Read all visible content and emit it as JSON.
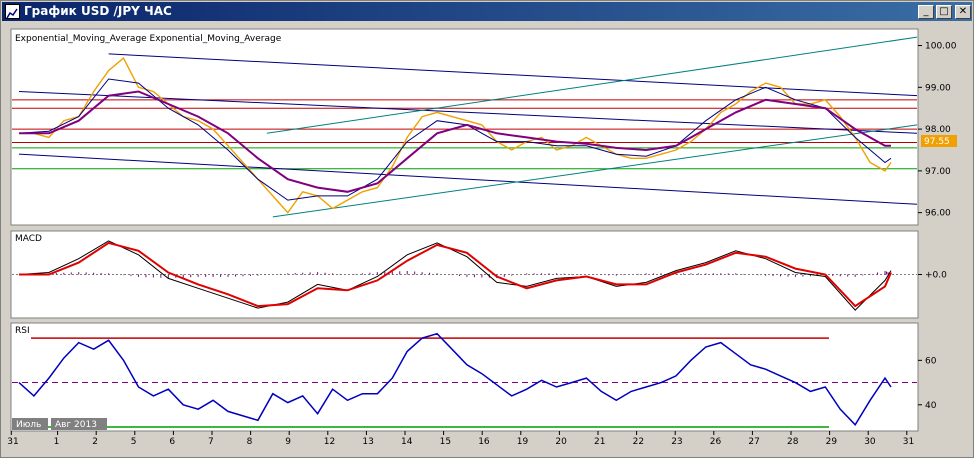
{
  "window": {
    "title": "График USD /JPY ЧАС",
    "minimize_glyph": "_",
    "maximize_glyph": "□",
    "close_glyph": "✕",
    "icon": "chart-icon"
  },
  "colors": {
    "background": "#d4d0c8",
    "plot_bg": "#ffffff",
    "price": "#f0a000",
    "ema_fast": "#000080",
    "ema_slow": "#800080",
    "channel": "#000080",
    "trend": "#008080",
    "resistance": "#c00000",
    "support": "#00a000",
    "macd_line": "#000000",
    "macd_signal": "#e00000",
    "macd_hist": "#800080",
    "rsi": "#0000c0"
  },
  "chart_data": [
    {
      "type": "line",
      "title": "Exponential_Moving_Average Exponential_Moving_Average",
      "yticks": [
        96.0,
        97.0,
        98.0,
        99.0,
        100.0
      ],
      "ylim": [
        95.8,
        100.3
      ],
      "current_price_label": "97.55",
      "current_price": 97.55,
      "horizontal_levels": [
        {
          "value": 98.7,
          "color": "#c00000"
        },
        {
          "value": 98.5,
          "color": "#c00000"
        },
        {
          "value": 98.0,
          "color": "#c00000"
        },
        {
          "value": 97.68,
          "color": "#c00000"
        },
        {
          "value": 97.55,
          "color": "#00a000"
        },
        {
          "value": 97.05,
          "color": "#00a000"
        }
      ],
      "series": [
        {
          "key": "price",
          "x": [
            0,
            0.5,
            1,
            1.5,
            2,
            2.5,
            3,
            3.5,
            4,
            4.5,
            5,
            5.5,
            6,
            6.5,
            7,
            7.5,
            8,
            8.5,
            9,
            9.5,
            10,
            10.5,
            11,
            11.5,
            12,
            12.5,
            13,
            13.5,
            14,
            14.5,
            15,
            15.5,
            16,
            16.5,
            17,
            17.5,
            18,
            18.5,
            19,
            19.5,
            20,
            20.5,
            21,
            21.5,
            22,
            22.5,
            23,
            23.5,
            24,
            24.5,
            25,
            25.5,
            26,
            26.5,
            27,
            27.5,
            28,
            28.5,
            29,
            29.2
          ],
          "values": [
            97.9,
            97.9,
            97.8,
            98.2,
            98.3,
            98.9,
            99.4,
            99.7,
            99.0,
            98.9,
            98.6,
            98.3,
            98.2,
            98.0,
            97.6,
            97.2,
            96.8,
            96.4,
            96.0,
            96.5,
            96.4,
            96.1,
            96.3,
            96.5,
            96.6,
            97.1,
            97.8,
            98.3,
            98.4,
            98.3,
            98.2,
            98.1,
            97.7,
            97.5,
            97.7,
            97.8,
            97.5,
            97.6,
            97.8,
            97.6,
            97.4,
            97.3,
            97.3,
            97.4,
            97.5,
            97.7,
            98.0,
            98.4,
            98.6,
            98.9,
            99.1,
            99.0,
            98.6,
            98.6,
            98.7,
            98.3,
            97.8,
            97.2,
            97.0,
            97.2
          ]
        },
        {
          "key": "ema_fast",
          "x": [
            0,
            1,
            2,
            3,
            4,
            5,
            6,
            7,
            8,
            9,
            10,
            11,
            12,
            13,
            14,
            15,
            16,
            17,
            18,
            19,
            20,
            21,
            22,
            23,
            24,
            25,
            26,
            27,
            28,
            29,
            29.2
          ],
          "values": [
            97.9,
            97.95,
            98.3,
            99.2,
            99.1,
            98.5,
            98.1,
            97.5,
            96.8,
            96.3,
            96.4,
            96.4,
            96.8,
            97.7,
            98.2,
            98.1,
            97.7,
            97.7,
            97.6,
            97.6,
            97.4,
            97.35,
            97.6,
            98.2,
            98.7,
            99.0,
            98.7,
            98.5,
            97.8,
            97.2,
            97.3
          ]
        },
        {
          "key": "ema_slow",
          "x": [
            0,
            1,
            2,
            3,
            4,
            5,
            6,
            7,
            8,
            9,
            10,
            11,
            12,
            13,
            14,
            15,
            16,
            17,
            18,
            19,
            20,
            21,
            22,
            23,
            24,
            25,
            26,
            27,
            28,
            29,
            29.2
          ],
          "values": [
            97.9,
            97.9,
            98.2,
            98.8,
            98.9,
            98.6,
            98.3,
            97.9,
            97.3,
            96.8,
            96.6,
            96.5,
            96.7,
            97.3,
            97.9,
            98.1,
            97.9,
            97.8,
            97.7,
            97.65,
            97.55,
            97.5,
            97.6,
            98.0,
            98.4,
            98.7,
            98.6,
            98.5,
            98.0,
            97.6,
            97.6
          ]
        }
      ],
      "trend_lines": [
        {
          "kind": "channel",
          "x": [
            0,
            32
          ],
          "y": [
            98.9,
            97.9
          ]
        },
        {
          "kind": "channel",
          "x": [
            0,
            32
          ],
          "y": [
            97.4,
            96.2
          ]
        },
        {
          "kind": "channel",
          "x": [
            3,
            32
          ],
          "y": [
            99.8,
            98.8
          ]
        },
        {
          "kind": "trend",
          "x": [
            8.5,
            32
          ],
          "y": [
            95.9,
            98.1
          ]
        },
        {
          "kind": "trend",
          "x": [
            8.3,
            31
          ],
          "y": [
            97.9,
            100.2
          ]
        }
      ]
    },
    {
      "type": "line",
      "title": "MACD",
      "yticks_labels": [
        "+0.0"
      ],
      "zero_line": 0,
      "ylim": [
        -1.0,
        1.0
      ],
      "series": [
        {
          "key": "macd_line",
          "x": [
            0,
            1,
            2,
            3,
            4,
            5,
            6,
            7,
            8,
            9,
            10,
            11,
            12,
            13,
            14,
            15,
            16,
            17,
            18,
            19,
            20,
            21,
            22,
            23,
            24,
            25,
            26,
            27,
            28,
            29,
            29.2
          ],
          "values": [
            0.0,
            0.05,
            0.4,
            0.85,
            0.5,
            -0.1,
            -0.35,
            -0.6,
            -0.85,
            -0.7,
            -0.25,
            -0.4,
            -0.05,
            0.5,
            0.8,
            0.45,
            -0.2,
            -0.3,
            -0.1,
            -0.05,
            -0.3,
            -0.2,
            0.1,
            0.3,
            0.6,
            0.4,
            0.05,
            -0.05,
            -0.9,
            -0.15,
            0.1
          ]
        },
        {
          "key": "macd_signal",
          "x": [
            0,
            1,
            2,
            3,
            4,
            5,
            6,
            7,
            8,
            9,
            10,
            11,
            12,
            13,
            14,
            15,
            16,
            17,
            18,
            19,
            20,
            21,
            22,
            23,
            24,
            25,
            26,
            27,
            28,
            29,
            29.2
          ],
          "values": [
            0.0,
            0.0,
            0.3,
            0.8,
            0.6,
            0.05,
            -0.25,
            -0.5,
            -0.8,
            -0.75,
            -0.35,
            -0.4,
            -0.15,
            0.35,
            0.75,
            0.55,
            -0.05,
            -0.35,
            -0.15,
            -0.05,
            -0.25,
            -0.25,
            0.05,
            0.25,
            0.55,
            0.45,
            0.15,
            0.0,
            -0.8,
            -0.3,
            0.05
          ]
        }
      ]
    },
    {
      "type": "line",
      "title": "RSI",
      "yticks": [
        40,
        60
      ],
      "ylim": [
        30,
        75
      ],
      "levels": [
        {
          "value": 70,
          "color": "#c00000"
        },
        {
          "value": 50,
          "color": "#800080",
          "dashed": true
        },
        {
          "value": 30,
          "color": "#00a000"
        }
      ],
      "series": [
        {
          "key": "rsi",
          "x": [
            0,
            0.5,
            1,
            1.5,
            2,
            2.5,
            3,
            3.5,
            4,
            4.5,
            5,
            5.5,
            6,
            6.5,
            7,
            7.5,
            8,
            8.5,
            9,
            9.5,
            10,
            10.5,
            11,
            11.5,
            12,
            12.5,
            13,
            13.5,
            14,
            14.5,
            15,
            15.5,
            16,
            16.5,
            17,
            17.5,
            18,
            18.5,
            19,
            19.5,
            20,
            20.5,
            21,
            21.5,
            22,
            22.5,
            23,
            23.5,
            24,
            24.5,
            25,
            25.5,
            26,
            26.5,
            27,
            27.5,
            28,
            28.5,
            29,
            29.2
          ],
          "values": [
            50,
            44,
            52,
            61,
            68,
            65,
            69,
            60,
            48,
            44,
            47,
            40,
            38,
            42,
            37,
            35,
            33,
            45,
            41,
            44,
            36,
            47,
            42,
            45,
            45,
            52,
            64,
            70,
            72,
            65,
            58,
            54,
            49,
            44,
            47,
            51,
            48,
            50,
            52,
            46,
            42,
            46,
            48,
            50,
            53,
            60,
            66,
            68,
            63,
            58,
            56,
            53,
            50,
            46,
            48,
            38,
            31,
            42,
            52,
            48
          ]
        }
      ]
    }
  ],
  "x_axis": {
    "ticks": [
      {
        "label": "31",
        "x": -0.2
      },
      {
        "label": "1",
        "x": 1
      },
      {
        "label": "2",
        "x": 2
      },
      {
        "label": "5",
        "x": 3
      },
      {
        "label": "6",
        "x": 4
      },
      {
        "label": "7",
        "x": 5
      },
      {
        "label": "8",
        "x": 6
      },
      {
        "label": "9",
        "x": 7
      },
      {
        "label": "12",
        "x": 8
      },
      {
        "label": "13",
        "x": 9
      },
      {
        "label": "14",
        "x": 10
      },
      {
        "label": "15",
        "x": 11
      },
      {
        "label": "16",
        "x": 12
      },
      {
        "label": "19",
        "x": 13
      },
      {
        "label": "20",
        "x": 14
      },
      {
        "label": "21",
        "x": 15
      },
      {
        "label": "22",
        "x": 16
      },
      {
        "label": "23",
        "x": 17
      },
      {
        "label": "26",
        "x": 18
      },
      {
        "label": "27",
        "x": 19
      },
      {
        "label": "28",
        "x": 20
      },
      {
        "label": "29",
        "x": 21
      },
      {
        "label": "30",
        "x": 22
      },
      {
        "label": "31",
        "x": 23
      }
    ],
    "month_labels": [
      "Июль",
      "Авг 2013"
    ]
  }
}
